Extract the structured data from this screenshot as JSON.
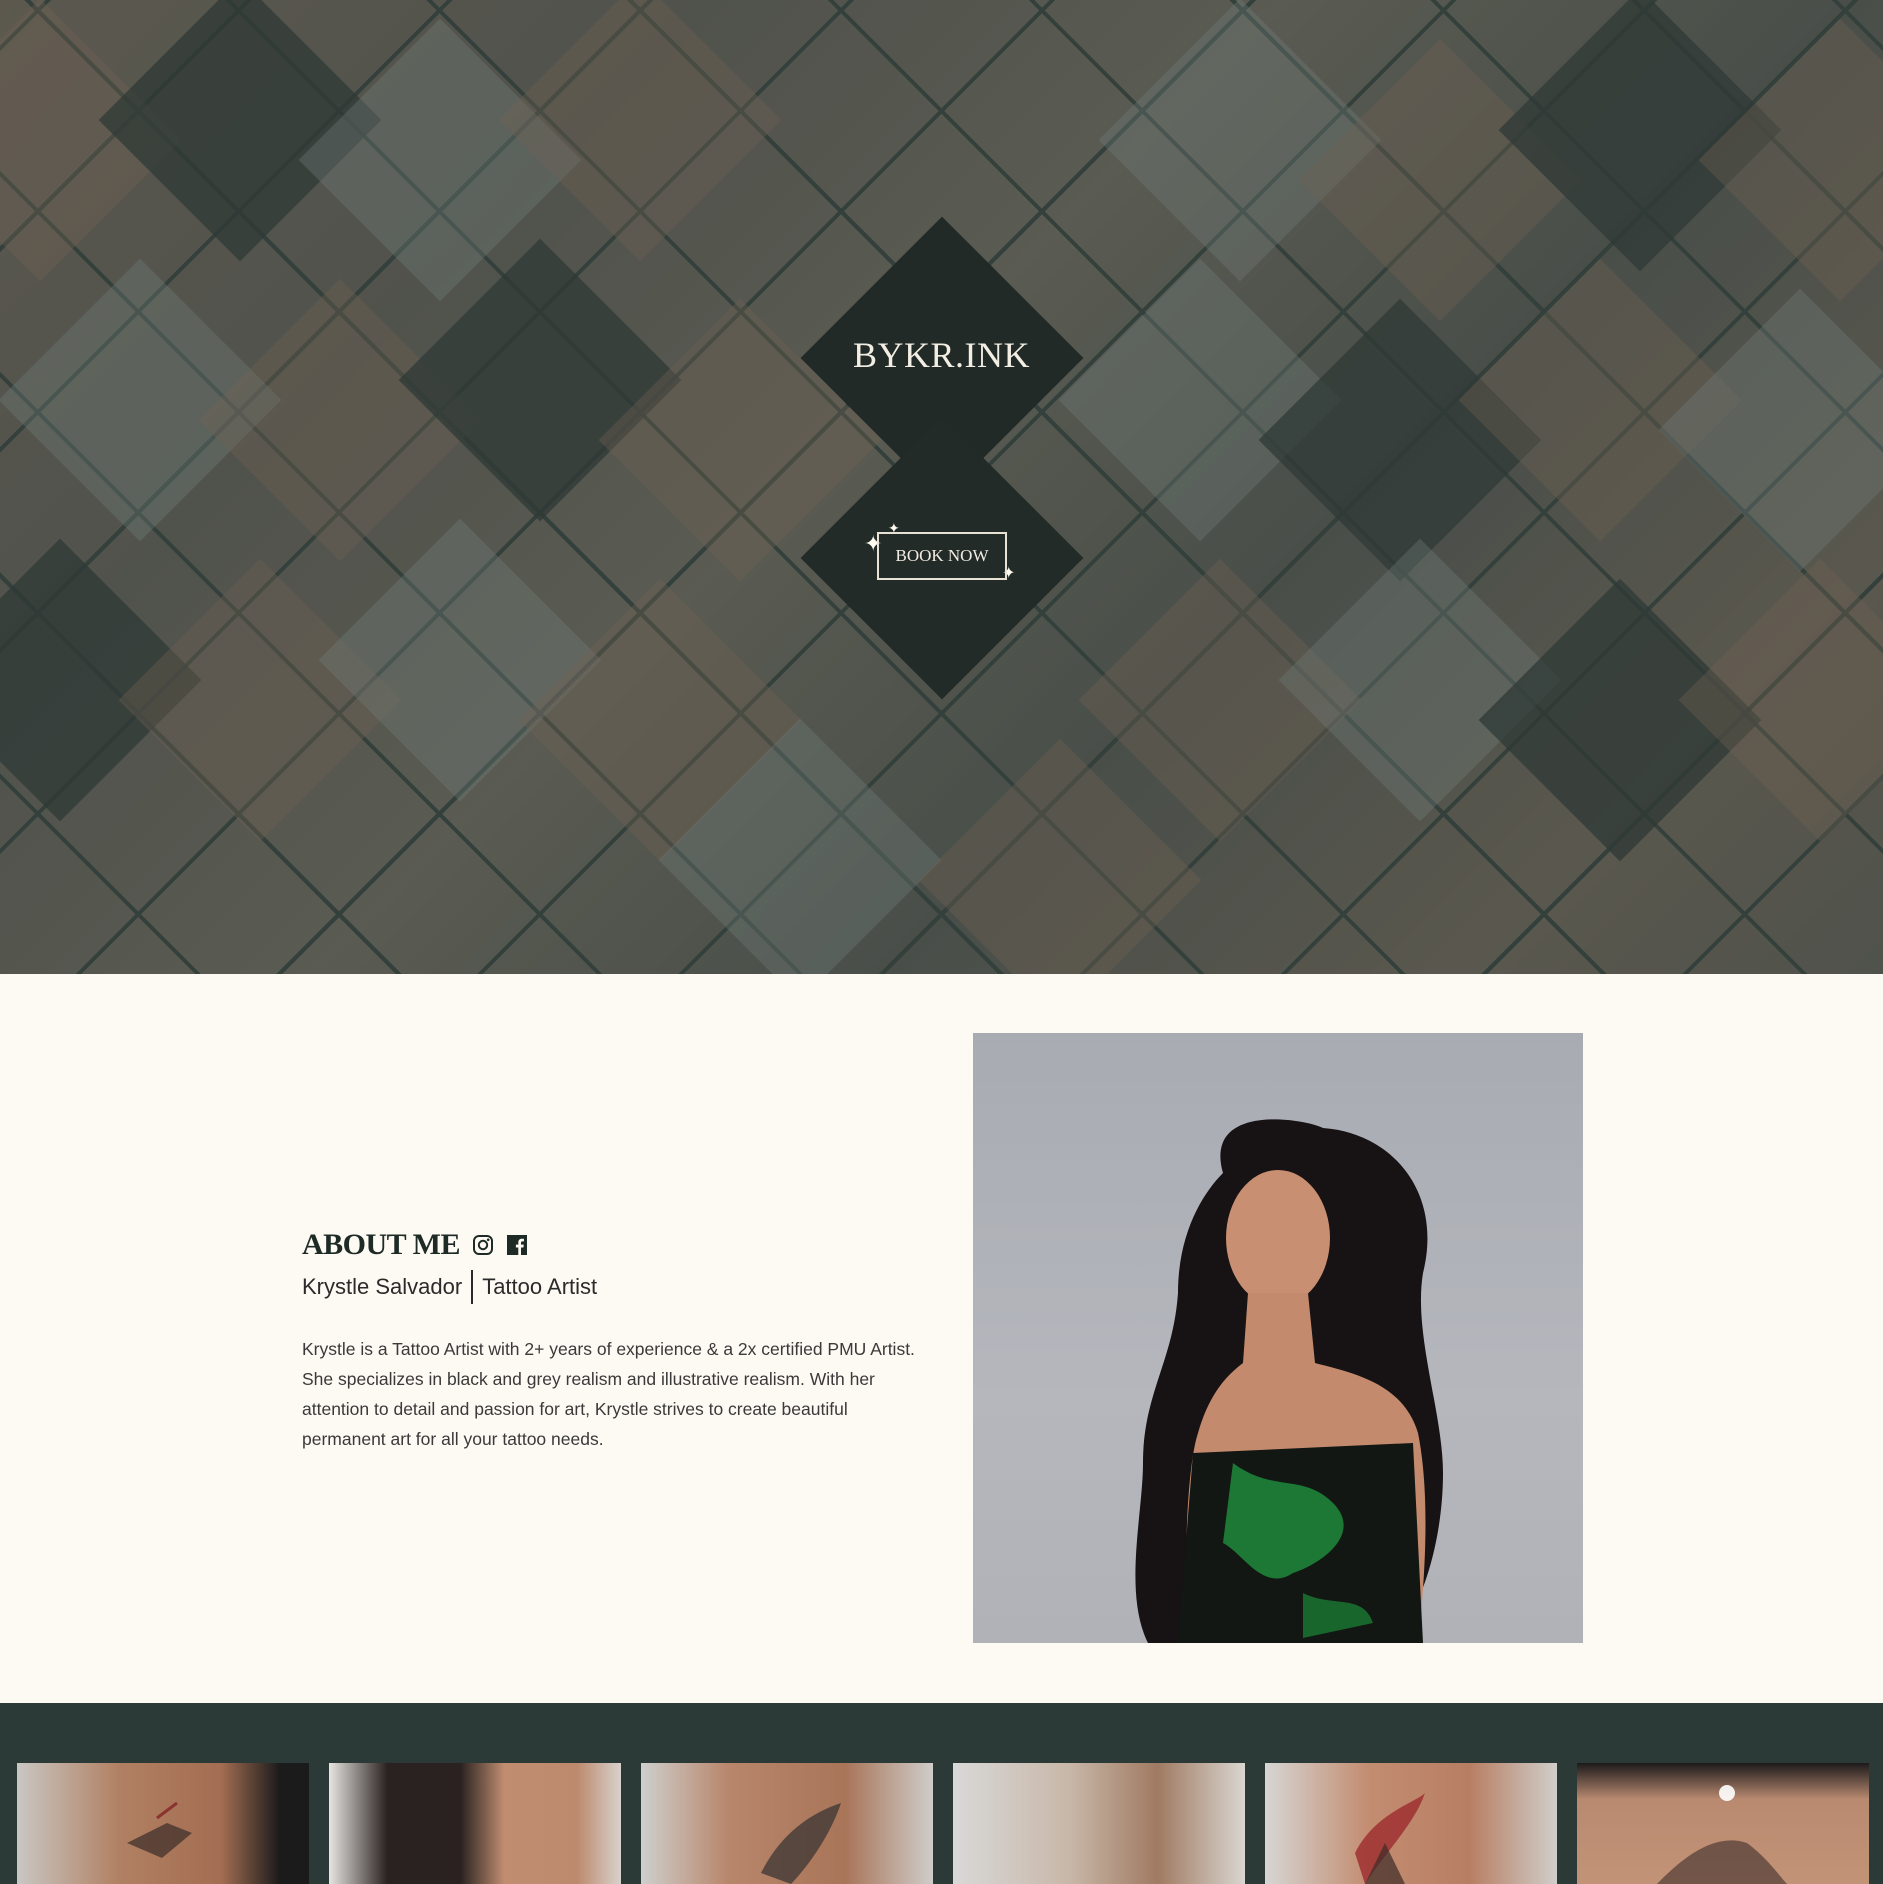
{
  "hero": {
    "brand": "BYKR.INK",
    "book_label": "BOOK NOW"
  },
  "about": {
    "title": "ABOUT ME",
    "name": "Krystle Salvador",
    "role": "Tattoo Artist",
    "bio": "Krystle is a Tattoo Artist with 2+ years of experience & a 2x certified PMU Artist. She specializes in black and grey realism and illustrative realism. With her attention to detail and passion for art, Krystle strives to create beautiful permanent art for all your tattoo needs.",
    "social_icons": [
      "instagram-icon",
      "facebook-icon"
    ]
  },
  "gallery": {
    "items": [
      "hummingbird tattoo",
      "neck tattoo",
      "bird tattoo",
      "arm tattoo",
      "red tiger tattoo",
      "floral hummingbird tattoo"
    ]
  },
  "colors": {
    "dark_green": "#2c3a37",
    "cream": "#fdf9f3",
    "text": "#1e2a26"
  }
}
